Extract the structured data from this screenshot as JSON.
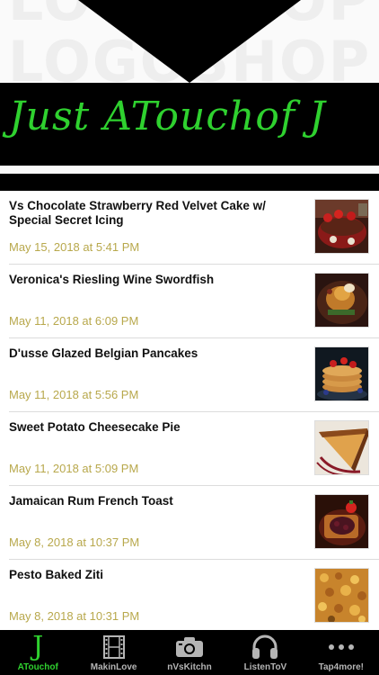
{
  "header": {
    "watermark_top": "LOGOSHOP",
    "watermark_bottom": "LOGOSHOP",
    "banner_text": "Just ATouchof J"
  },
  "posts": [
    {
      "title": "Vs Chocolate Strawberry Red Velvet Cake w/ Special Secret Icing",
      "date": "May 15, 2018 at 5:41 PM",
      "thumb": "red-velvet-cake"
    },
    {
      "title": "Veronica's Riesling Wine Swordfish",
      "date": "May 11, 2018 at 6:09 PM",
      "thumb": "swordfish-plate"
    },
    {
      "title": "D'usse Glazed Belgian Pancakes",
      "date": "May 11, 2018 at 5:56 PM",
      "thumb": "pancake-stack"
    },
    {
      "title": "Sweet Potato Cheesecake Pie",
      "date": "May 11, 2018 at 5:09 PM",
      "thumb": "pie-slice"
    },
    {
      "title": "Jamaican Rum French Toast",
      "date": "May 8, 2018 at 10:37 PM",
      "thumb": "french-toast"
    },
    {
      "title": "Pesto Baked Ziti",
      "date": "May 8, 2018 at 10:31 PM",
      "thumb": "baked-ziti"
    }
  ],
  "tabs": [
    {
      "label": "ATouchof",
      "icon": "j-letter-icon",
      "active": true
    },
    {
      "label": "MakinLove",
      "icon": "film-icon",
      "active": false
    },
    {
      "label": "nVsKitchn",
      "icon": "camera-icon",
      "active": false
    },
    {
      "label": "ListenToV",
      "icon": "headphones-icon",
      "active": false
    },
    {
      "label": "Tap4more!",
      "icon": "more-dots-icon",
      "active": false
    }
  ],
  "colors": {
    "accent_green": "#2fd12f",
    "date_gold": "#b8a84c",
    "tab_inactive": "#b5b5b5",
    "header_black": "#000000"
  }
}
